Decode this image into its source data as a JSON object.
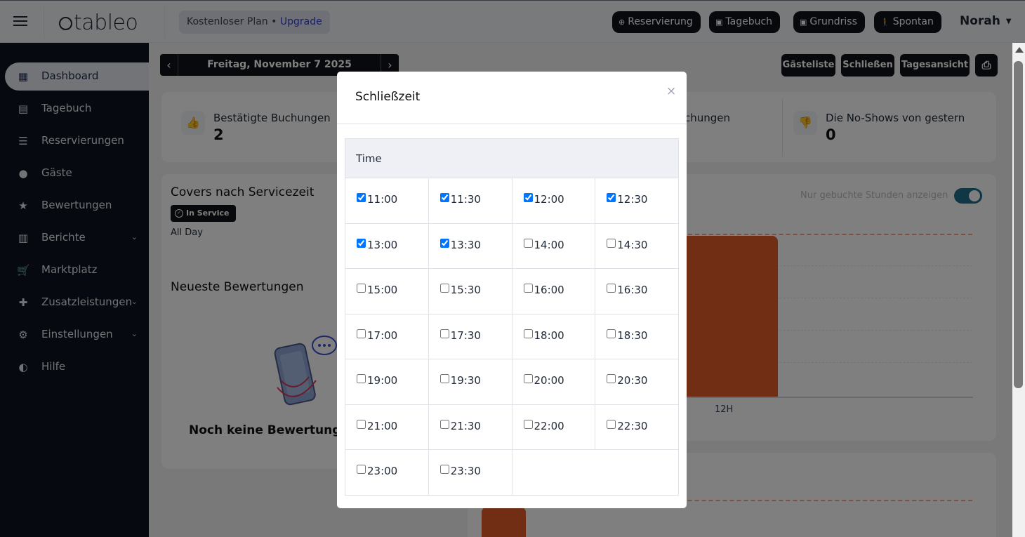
{
  "brand": {
    "logo_text": "tableo"
  },
  "plan": {
    "label": "Kostenloser Plan",
    "separator": " • ",
    "upgrade": "Upgrade"
  },
  "top_actions": [
    {
      "icon": "plus-circle-icon",
      "glyph": "⊕",
      "label": "Reservierung"
    },
    {
      "icon": "calendar-icon",
      "glyph": "▣",
      "label": "Tagebuch"
    },
    {
      "icon": "floorplan-icon",
      "glyph": "▣",
      "label": "Grundriss"
    },
    {
      "icon": "walk-in-icon",
      "glyph": "🚶",
      "label": "Spontan"
    }
  ],
  "user": {
    "name": "Norah"
  },
  "sidebar": {
    "items": [
      {
        "label": "Dashboard",
        "icon": "dashboard-icon",
        "glyph": "▦",
        "active": true,
        "has_chevron": false
      },
      {
        "label": "Tagebuch",
        "icon": "book-icon",
        "glyph": "▤",
        "active": false,
        "has_chevron": false
      },
      {
        "label": "Reservierungen",
        "icon": "list-icon",
        "glyph": "☰",
        "active": false,
        "has_chevron": false
      },
      {
        "label": "Gäste",
        "icon": "user-icon",
        "glyph": "●",
        "active": false,
        "has_chevron": false
      },
      {
        "label": "Bewertungen",
        "icon": "star-icon",
        "glyph": "★",
        "active": false,
        "has_chevron": false
      },
      {
        "label": "Berichte",
        "icon": "bar-chart-icon",
        "glyph": "▥",
        "active": false,
        "has_chevron": true
      },
      {
        "label": "Marktplatz",
        "icon": "cart-icon",
        "glyph": "🛒",
        "active": false,
        "has_chevron": false
      },
      {
        "label": "Zusatzleistungen",
        "icon": "puzzle-icon",
        "glyph": "✚",
        "active": false,
        "has_chevron": true
      },
      {
        "label": "Einstellungen",
        "icon": "gear-icon",
        "glyph": "⚙",
        "active": false,
        "has_chevron": true
      },
      {
        "label": "Hilfe",
        "icon": "headset-icon",
        "glyph": "◐",
        "active": false,
        "has_chevron": false
      }
    ]
  },
  "date_nav": {
    "date": "Freitag, November 7 2025",
    "prev": "‹",
    "next": "›"
  },
  "page_actions": {
    "guestlist": "Gästeliste",
    "close": "Schließen",
    "day_view": "Tagesansicht",
    "print_glyph": "⎙"
  },
  "stats": {
    "confirmed_label": "Bestätigte Buchungen",
    "confirmed_value": "2",
    "partial_label": "chungen",
    "noshow_label": "Die No-Shows von gestern",
    "noshow_value": "0"
  },
  "covers_card": {
    "title": "Covers nach Servicezeit",
    "badge": "In Service",
    "filter": "All Day",
    "toggle_label": "Nur gebuchte Stunden anzeigen",
    "toggle_on": true,
    "x_label": "12H"
  },
  "reviews_card": {
    "title": "Neueste Bewertungen",
    "empty_text": "Noch keine Bewertungen"
  },
  "modal": {
    "title": "Schließzeit",
    "close_glyph": "×",
    "column_header": "Time",
    "slots": [
      {
        "time": "11:00",
        "checked": true
      },
      {
        "time": "11:30",
        "checked": true
      },
      {
        "time": "12:00",
        "checked": true
      },
      {
        "time": "12:30",
        "checked": true
      },
      {
        "time": "13:00",
        "checked": true
      },
      {
        "time": "13:30",
        "checked": true
      },
      {
        "time": "14:00",
        "checked": false
      },
      {
        "time": "14:30",
        "checked": false
      },
      {
        "time": "15:00",
        "checked": false
      },
      {
        "time": "15:30",
        "checked": false
      },
      {
        "time": "16:00",
        "checked": false
      },
      {
        "time": "16:30",
        "checked": false
      },
      {
        "time": "17:00",
        "checked": false
      },
      {
        "time": "17:30",
        "checked": false
      },
      {
        "time": "18:00",
        "checked": false
      },
      {
        "time": "18:30",
        "checked": false
      },
      {
        "time": "19:00",
        "checked": false
      },
      {
        "time": "19:30",
        "checked": false
      },
      {
        "time": "20:00",
        "checked": false
      },
      {
        "time": "20:30",
        "checked": false
      },
      {
        "time": "21:00",
        "checked": false
      },
      {
        "time": "21:30",
        "checked": false
      },
      {
        "time": "22:00",
        "checked": false
      },
      {
        "time": "22:30",
        "checked": false
      },
      {
        "time": "23:00",
        "checked": false
      },
      {
        "time": "23:30",
        "checked": false
      }
    ]
  },
  "colors": {
    "sidebar_bg": "#0e1321",
    "accent_orange": "#e55a2b",
    "toggle_on": "#1e6e8c",
    "dark_button": "#111318"
  }
}
